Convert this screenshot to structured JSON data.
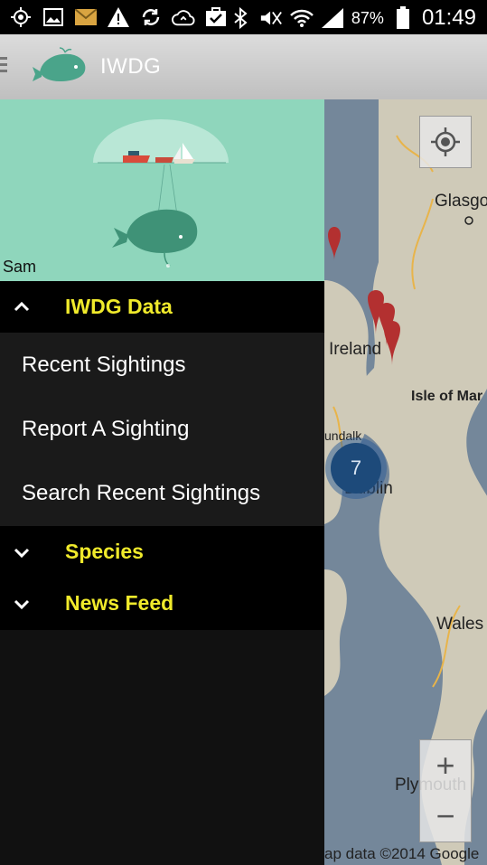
{
  "status_bar": {
    "battery": "87%",
    "time": "01:49",
    "icons": [
      "location-icon",
      "image-icon",
      "mail-icon",
      "warning-icon",
      "sync-icon",
      "cloud-sync-icon",
      "task-icon",
      "bluetooth-icon",
      "mute-icon",
      "wifi-icon",
      "signal-icon",
      "battery-icon"
    ]
  },
  "action_bar": {
    "title": "IWDG",
    "logo": "whale-logo"
  },
  "drawer": {
    "user_name": "Sam",
    "groups": [
      {
        "label": "IWDG Data",
        "expanded": true,
        "items": [
          "Recent Sightings",
          "Report A Sighting",
          "Search Recent Sightings"
        ]
      },
      {
        "label": "Species",
        "expanded": false
      },
      {
        "label": "News Feed",
        "expanded": false
      }
    ]
  },
  "map": {
    "labels": {
      "glasgow": "Glasgo",
      "ireland": "Ireland",
      "isle_of_man": "Isle of Mar",
      "dundalk": "undalk",
      "dublin": "Dublin",
      "wales": "Wales",
      "plymouth": "Plymouth"
    },
    "cluster_count": "7",
    "zoom_in": "+",
    "zoom_out": "−",
    "copyright": "ap data ©2014 Google"
  },
  "colors": {
    "accent_yellow": "#f0ea2b",
    "header_teal": "#8fd6bc",
    "marker_red": "#c0392b",
    "cluster_blue": "#1d4a7a"
  }
}
